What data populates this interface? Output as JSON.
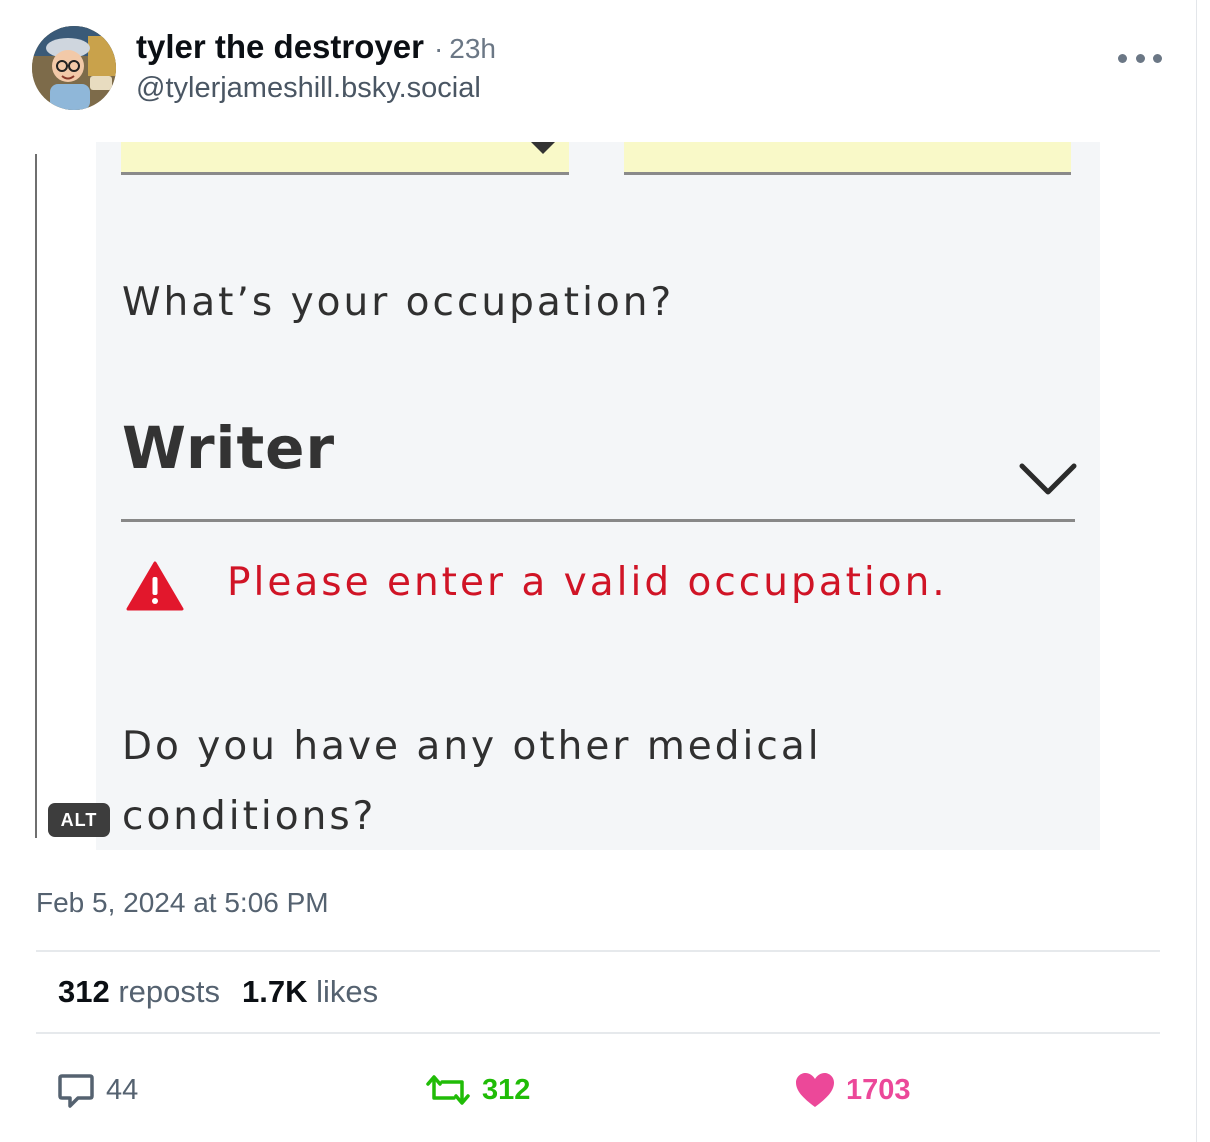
{
  "post": {
    "author": {
      "display_name": "tyler the destroyer",
      "separator": "·",
      "time_ago": "23h",
      "handle": "@tylerjameshill.bsky.social"
    },
    "image": {
      "alt_badge": "ALT",
      "question_occupation": "What’s your occupation?",
      "answer": "Writer",
      "error_message": "Please enter a valid occupation.",
      "question_medical_line1": "Do you have any other medical",
      "question_medical_line2": "conditions?",
      "colors": {
        "error": "#d01426",
        "field_highlight": "#f9f9c8",
        "background": "#f4f6f8"
      }
    },
    "timestamp": "Feb 5, 2024 at 5:06 PM",
    "stats": {
      "reposts_count": "312",
      "reposts_label": "reposts",
      "likes_count": "1.7K",
      "likes_label": "likes"
    },
    "actions": {
      "reply_count": "44",
      "repost_count": "312",
      "like_count": "1703",
      "icons": [
        "reply-icon",
        "repost-icon",
        "like-icon"
      ],
      "colors": {
        "reply": "#556270",
        "repost": "#20bc07",
        "like": "#ec4899"
      }
    }
  }
}
